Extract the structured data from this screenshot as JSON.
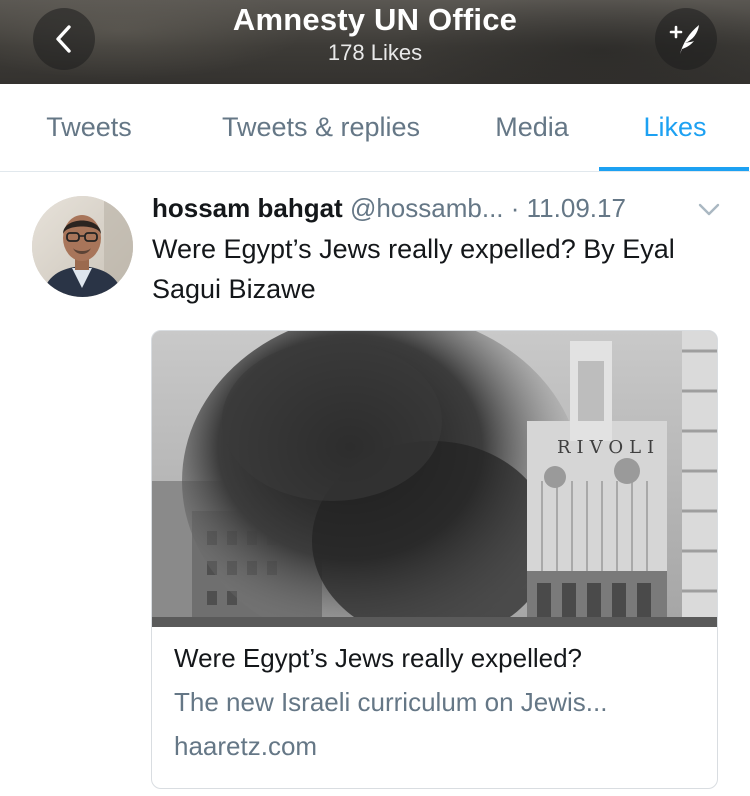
{
  "header": {
    "title": "Amnesty UN Office",
    "subtitle": "178 Likes",
    "back_icon": "chevron-left-icon",
    "compose_icon": "compose-tweet-icon"
  },
  "tabs": [
    {
      "label": "Tweets",
      "active": false
    },
    {
      "label": "Tweets & replies",
      "active": false
    },
    {
      "label": "Media",
      "active": false
    },
    {
      "label": "Likes",
      "active": true
    }
  ],
  "tweet": {
    "author_name": "hossam bahgat",
    "handle": "@hossamb...",
    "separator": "·",
    "date": "11.09.17",
    "text": "Were Egypt’s Jews really expelled? By Eyal Sagui Bizawe",
    "menu_icon": "chevron-down-icon",
    "card": {
      "title": "Were Egypt’s Jews really expelled?",
      "description": "The new Israeli curriculum on Jewis...",
      "domain": "haaretz.com",
      "image_lettering": "RIVOLI"
    }
  },
  "colors": {
    "accent": "#1da1f2",
    "secondary_text": "#657786",
    "primary_text": "#14171a",
    "divider": "#e1e8ed"
  }
}
